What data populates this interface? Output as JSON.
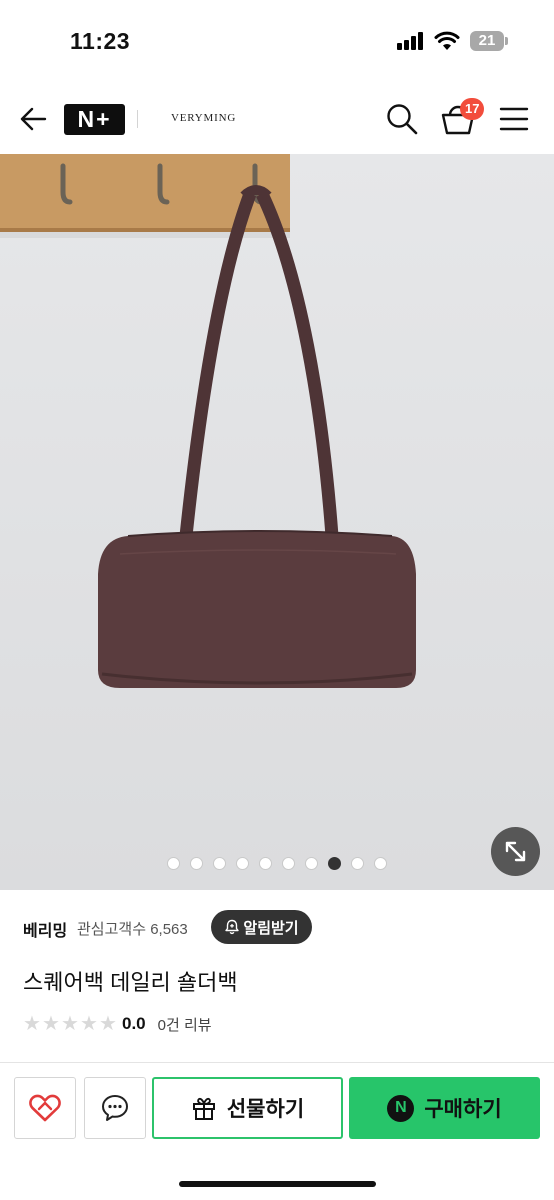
{
  "status_bar": {
    "time": "11:23",
    "battery": "21"
  },
  "header": {
    "logo": "N+",
    "brand": "VERYMING",
    "cart_count": "17",
    "icons": {
      "back": "arrow-left-icon",
      "search": "search-icon",
      "cart": "shopping-basket-icon",
      "menu": "hamburger-menu-icon"
    }
  },
  "gallery": {
    "image": "brown-leather-shoulder-bag-on-wall-hook",
    "slide_count": 10,
    "active_index": 7,
    "expand_icon": "expand-arrows-icon"
  },
  "store": {
    "name": "베리밍",
    "followers_label": "관심고객수",
    "followers_value": "6,563",
    "alert_label": "알림받기"
  },
  "product": {
    "title": "스퀘어백 데일리 숄더백",
    "rating": "0.0",
    "rating_fraction": 0,
    "review_text": "0건 리뷰"
  },
  "actions": {
    "wish_icon": "heart-icon",
    "talk_icon": "chat-bubble-icon",
    "gift_label": "선물하기",
    "gift_icon": "gift-icon",
    "buy_label": "구매하기",
    "buy_badge": "N"
  },
  "colors": {
    "accent_green": "#27c56a",
    "badge_red": "#f24d3c",
    "bag_brown": "#5a3c3e"
  }
}
